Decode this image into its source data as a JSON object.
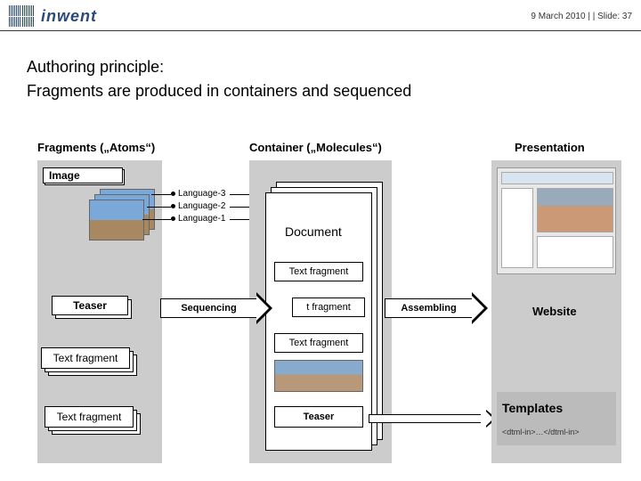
{
  "header": {
    "brand": "inwent",
    "meta": "9 March 2010 |  | Slide: 37"
  },
  "title": {
    "line1": "Authoring principle:",
    "line2": "Fragments are produced in containers and sequenced"
  },
  "columns": {
    "left": "Fragments („Atoms“)",
    "mid": "Container („Molecules“)",
    "right": "Presentation"
  },
  "fragments": {
    "image": "Image",
    "lang3": "Language-3",
    "lang2": "Language-2",
    "lang1": "Language-1",
    "teaser": "Teaser",
    "tf1": "Text fragment",
    "tf2": "Text fragment"
  },
  "container": {
    "doc": "Document",
    "tf_a": "Text fragment",
    "tf_b": "t fragment",
    "tf_c": "Text fragment",
    "teaser": "Teaser"
  },
  "arrows": {
    "seq": "Sequencing",
    "asm": "Assembling"
  },
  "presentation": {
    "website": "Website",
    "templates": "Templates",
    "code": "<dtml-in>…</dtml-in>"
  }
}
